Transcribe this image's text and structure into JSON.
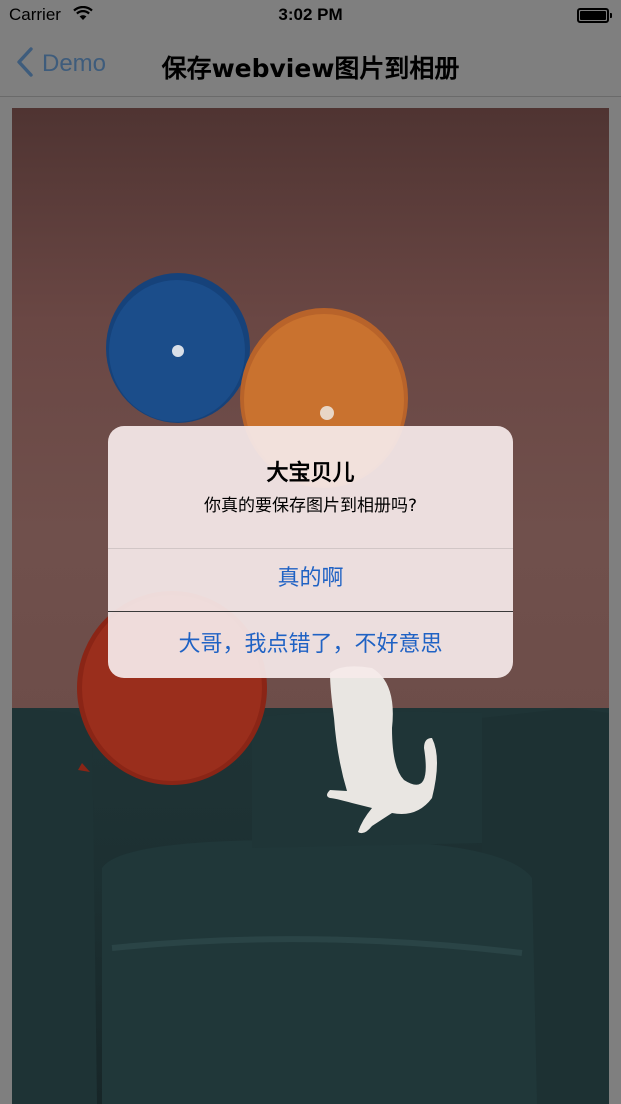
{
  "status_bar": {
    "carrier": "Carrier",
    "time": "3:02 PM"
  },
  "nav": {
    "back_label": "Demo",
    "title": "保存webview图片到相册"
  },
  "alert": {
    "title": "大宝贝儿",
    "message": "你真的要保存图片到相册吗?",
    "buttons": [
      "真的啊",
      "大哥，我点错了，不好意思"
    ]
  },
  "colors": {
    "action_blue": "#1f62c4",
    "dim_overlay": "#7f7f7f"
  }
}
